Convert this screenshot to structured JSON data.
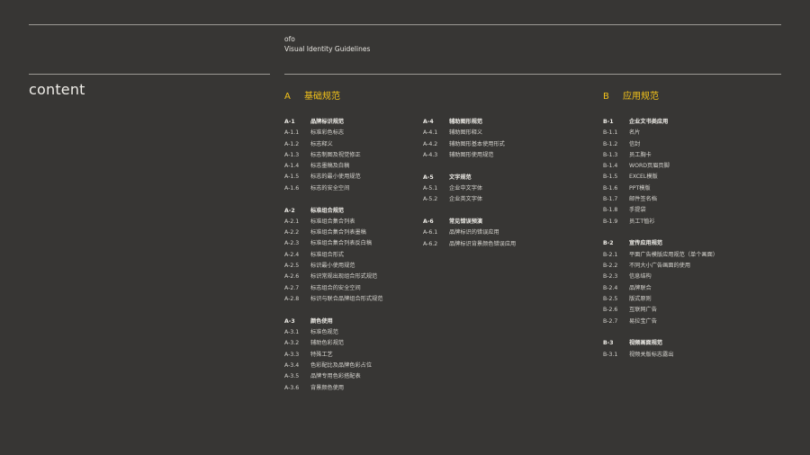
{
  "header": {
    "brand": "ofo",
    "subtitle": "Visual Identity Guidelines"
  },
  "content_title": "content",
  "sections": {
    "A": {
      "letter": "A",
      "title": "基础规范"
    },
    "B": {
      "letter": "B",
      "title": "应用规范"
    }
  },
  "columns": [
    [
      {
        "code": "A-1",
        "title": "品牌标识规范",
        "items": [
          {
            "code": "A-1.1",
            "label": "标准彩色标志"
          },
          {
            "code": "A-1.2",
            "label": "标志释义"
          },
          {
            "code": "A-1.3",
            "label": "标志制图及视觉修正"
          },
          {
            "code": "A-1.4",
            "label": "标志墨稿及白稿"
          },
          {
            "code": "A-1.5",
            "label": "标志的最小使用规范"
          },
          {
            "code": "A-1.6",
            "label": "标志的安全空间"
          }
        ]
      },
      {
        "code": "A-2",
        "title": "标准组合规范",
        "items": [
          {
            "code": "A-2.1",
            "label": "标准组合集合列表"
          },
          {
            "code": "A-2.2",
            "label": "标准组合集合列表墨稿"
          },
          {
            "code": "A-2.3",
            "label": "标准组合集合列表反白稿"
          },
          {
            "code": "A-2.4",
            "label": "标准组合形式"
          },
          {
            "code": "A-2.5",
            "label": "标识最小使用规范"
          },
          {
            "code": "A-2.6",
            "label": "标识常规出现组合形式规范"
          },
          {
            "code": "A-2.7",
            "label": "标志组合的安全空间"
          },
          {
            "code": "A-2.8",
            "label": "标识与联合品牌组合形式规范"
          }
        ]
      },
      {
        "code": "A-3",
        "title": "颜色使用",
        "items": [
          {
            "code": "A-3.1",
            "label": "标准色规范"
          },
          {
            "code": "A-3.2",
            "label": "辅助色彩规范"
          },
          {
            "code": "A-3.3",
            "label": "特殊工艺"
          },
          {
            "code": "A-3.4",
            "label": "色彩配比及品牌色彩占位"
          },
          {
            "code": "A-3.5",
            "label": "品牌专用色彩搭配表"
          },
          {
            "code": "A-3.6",
            "label": "背景颜色使用"
          }
        ]
      }
    ],
    [
      {
        "code": "A-4",
        "title": "辅助图形规范",
        "items": [
          {
            "code": "A-4.1",
            "label": "辅助图形释义"
          },
          {
            "code": "A-4.2",
            "label": "辅助图形基本使用形式"
          },
          {
            "code": "A-4.3",
            "label": "辅助图形使用规范"
          }
        ]
      },
      {
        "code": "A-5",
        "title": "文字规范",
        "items": [
          {
            "code": "A-5.1",
            "label": "企业中文字体"
          },
          {
            "code": "A-5.2",
            "label": "企业英文字体"
          }
        ]
      },
      {
        "code": "A-6",
        "title": "常见错误预演",
        "items": [
          {
            "code": "A-6.1",
            "label": "品牌标识的错误应用"
          },
          {
            "code": "A-6.2",
            "label": "品牌标识背景颜色错误应用"
          }
        ]
      }
    ],
    [
      {
        "code": "B-1",
        "title": "企业文书类应用",
        "items": [
          {
            "code": "B-1.1",
            "label": "名片"
          },
          {
            "code": "B-1.2",
            "label": "信封"
          },
          {
            "code": "B-1.3",
            "label": "员工胸卡"
          },
          {
            "code": "B-1.4",
            "label": "WORD页眉页脚"
          },
          {
            "code": "B-1.5",
            "label": "EXCEL模版"
          },
          {
            "code": "B-1.6",
            "label": "PPT模版"
          },
          {
            "code": "B-1.7",
            "label": "邮件签名档"
          },
          {
            "code": "B-1.8",
            "label": "手提袋"
          },
          {
            "code": "B-1.9",
            "label": "员工T恤衫"
          }
        ]
      },
      {
        "code": "B-2",
        "title": "宣传应用规范",
        "items": [
          {
            "code": "B-2.1",
            "label": "平面广告模版应用规范（单个画面）"
          },
          {
            "code": "B-2.2",
            "label": "不同大小广告画面的使用"
          },
          {
            "code": "B-2.3",
            "label": "信息结构"
          },
          {
            "code": "B-2.4",
            "label": "品牌联合"
          },
          {
            "code": "B-2.5",
            "label": "版式原则"
          },
          {
            "code": "B-2.6",
            "label": "互联网广告"
          },
          {
            "code": "B-2.7",
            "label": "易拉宝广告"
          }
        ]
      },
      {
        "code": "B-3",
        "title": "视频画面规范",
        "items": [
          {
            "code": "B-3.1",
            "label": "视频关版标志露出"
          }
        ]
      }
    ]
  ]
}
